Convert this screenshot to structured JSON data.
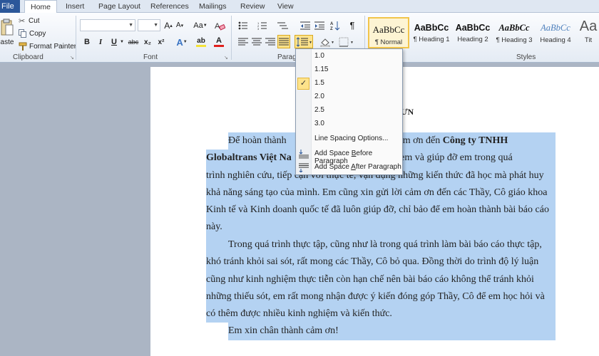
{
  "tabs": {
    "file": "File",
    "items": [
      "Home",
      "Insert",
      "Page Layout",
      "References",
      "Mailings",
      "Review",
      "View"
    ],
    "active": "Home"
  },
  "clipboard": {
    "paste": "aste",
    "cut": "Cut",
    "copy": "Copy",
    "format_painter": "Format Painter",
    "label": "Clipboard"
  },
  "font": {
    "label": "Font",
    "family_value": "",
    "size_value": "",
    "bold": "B",
    "italic": "I",
    "underline": "U",
    "strike": "abc",
    "subscript": "x₂",
    "superscript": "x²",
    "grow": "A",
    "shrink": "A",
    "change_case": "Aa",
    "text_effects": "A",
    "highlight": "ab",
    "font_color": "A",
    "font_color_hex": "#e0201c",
    "highlight_hex": "#f4e23a"
  },
  "paragraph": {
    "label": "Paragr",
    "pilcrow": "¶"
  },
  "styles": {
    "label": "Styles",
    "items": [
      {
        "sample": "AaBbCc",
        "name": "¶ Normal"
      },
      {
        "sample": "AaBbCc",
        "name": "¶ Heading 1"
      },
      {
        "sample": "AaBbCc",
        "name": "Heading 2"
      },
      {
        "sample": "AaBbCc",
        "name": "¶ Heading 3"
      },
      {
        "sample": "AaBbCc",
        "name": "Heading 4"
      },
      {
        "sample": "Aa",
        "name": "Tit"
      }
    ]
  },
  "line_spacing_menu": {
    "options": [
      "1.0",
      "1.15",
      "1.5",
      "2.0",
      "2.5",
      "3.0"
    ],
    "checked": "1.5",
    "options_link": "Line Spacing Options...",
    "before_pre": "Add Space ",
    "before_key": "B",
    "before_post": "efore Paragraph",
    "after_pre": "Add Space ",
    "after_key": "A",
    "after_post": "fter Paragraph"
  },
  "document": {
    "heading": "ƯN",
    "p1_lines": [
      [
        "Để hoàn thành",
        "gửi lời cảm ơn đến ",
        "Công ty TNHH"
      ],
      [
        "Globaltrans Việt Na",
        "lợi cho em và giúp đỡ em trong quá"
      ],
      [
        "trình nghiên cứu, tiếp cận với thực tế, vận dụng những kiến thức đã học mà phát huy"
      ],
      [
        "khả năng sáng tạo của mình. Em cũng xin gửi lời cảm ơn đến các Thầy, Cô giáo khoa"
      ],
      [
        "Kinh tế và Kinh doanh quốc tế đã luôn giúp đỡ, chỉ bảo để em hoàn thành bài báo cáo"
      ],
      [
        "này."
      ]
    ],
    "p2_lines": [
      [
        "Trong quá trình thực tập, cũng như là trong quá trình làm bài báo cáo thực tập,"
      ],
      [
        "khó tránh khỏi sai sót, rất mong các Thầy, Cô bỏ qua. Đồng thời do trình độ lý luận"
      ],
      [
        "cũng như kinh nghiệm thực tiễn còn hạn chế nên bài báo cáo không thể tránh khỏi"
      ],
      [
        "những thiếu sót, em rất mong nhận được ý kiến đóng góp Thầy, Cô để em học hỏi và"
      ],
      [
        "có thêm được nhiều kinh nghiệm và kiến thức."
      ]
    ],
    "p3": "Em xin chân thành cảm ơn!",
    "highlight_hex": "#b4d2f2"
  }
}
